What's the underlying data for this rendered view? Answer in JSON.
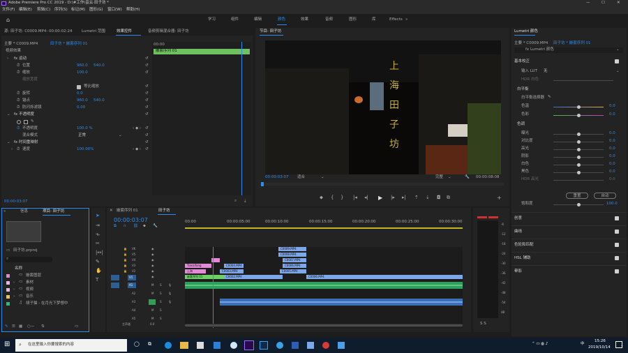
{
  "app": {
    "title": "Adobe Premiere Pro CC 2019 - D:\\#工作\\音云·田子坊 *",
    "min": "—",
    "max": "☐",
    "close": "✕"
  },
  "menu": [
    "文件(F)",
    "编辑(E)",
    "剪辑(C)",
    "序列(S)",
    "标记(M)",
    "图形(G)",
    "窗口(W)",
    "帮助(H)"
  ],
  "workspaces": [
    "学习",
    "组件",
    "编辑",
    "颜色",
    "效果",
    "音频",
    "图形",
    "库",
    "Effects"
  ],
  "source_panel": {
    "label": "源: 田子坊: C0009.MP4: 00:00:02:24",
    "tabs": [
      "Lumetri 范围",
      "效果控件",
      "音频剪辑混合器: 田子坊"
    ],
    "clip_path": "主要 * C0009.MP4",
    "seq_path": "田子坊 * 嵌套序列 01",
    "mini_time": "00:00",
    "mini_clip": "嵌套序列 01",
    "bottom_time": "00:00:03:07"
  },
  "effects": {
    "section": "视频效果",
    "rows": [
      {
        "label": "fx 运动",
        "v1": "",
        "v2": ""
      },
      {
        "label": "位置",
        "v1": "960.0",
        "v2": "540.0"
      },
      {
        "label": "缩放",
        "v1": "100.0",
        "v2": ""
      },
      {
        "label": "缩放宽度",
        "v1": "",
        "v2": ""
      },
      {
        "label": "等比缩放",
        "v1": "",
        "v2": ""
      },
      {
        "label": "旋转",
        "v1": "0.0",
        "v2": ""
      },
      {
        "label": "锚点",
        "v1": "960.0",
        "v2": "540.0"
      },
      {
        "label": "防闪烁滤镜",
        "v1": "0.00",
        "v2": ""
      },
      {
        "label": "fx 不透明度",
        "v1": "",
        "v2": ""
      },
      {
        "label": "不透明度",
        "v1": "100.0 %",
        "v2": ""
      },
      {
        "label": "混合模式",
        "v1": "正常",
        "v2": ""
      },
      {
        "label": "fx 时间重映射",
        "v1": "",
        "v2": ""
      },
      {
        "label": "速度",
        "v1": "100.00%",
        "v2": ""
      }
    ]
  },
  "program": {
    "label": "节目: 田子坊",
    "time_left": "00:00:03:07",
    "fit": "适合",
    "quality": "完整",
    "time_right": "00:00:08:08",
    "sign_text": [
      "上",
      "海",
      "田",
      "子",
      "坊"
    ]
  },
  "lumetri": {
    "title": "Lumetri 颜色",
    "path_left": "主要 * C0009.MP4",
    "path_right": "田子坊 * 嵌套序列 01",
    "fx": "fx Lumetri 颜色",
    "basic": "基本校正",
    "lut_label": "输入 LUT",
    "lut_value": "无",
    "hdr": "HDR 白色",
    "wb_section": "白平衡",
    "wb_picker": "白平衡选择器",
    "temp": {
      "label": "色温",
      "value": "0.0"
    },
    "tint": {
      "label": "色彩",
      "value": "0.0"
    },
    "tone": "色调",
    "tone_rows": [
      {
        "label": "曝光",
        "value": "0.0"
      },
      {
        "label": "对比度",
        "value": "0.0"
      },
      {
        "label": "高光",
        "value": "0.0"
      },
      {
        "label": "阴影",
        "value": "0.0"
      },
      {
        "label": "白色",
        "value": "0.0"
      },
      {
        "label": "黑色",
        "value": "0.0"
      },
      {
        "label": "HDR 高光",
        "value": "0.0"
      }
    ],
    "reset": "重置",
    "auto": "自动",
    "sat": {
      "label": "饱和度",
      "value": "100.0"
    },
    "sections": [
      "创意",
      "曲线",
      "色轮和匹配",
      "HSL 辅助",
      "晕影"
    ]
  },
  "project": {
    "tabs": [
      "项目: 田子坊",
      "媒体浏览器",
      "信息"
    ],
    "file": "田子坊.prproj",
    "search_placeholder": "",
    "col_header": "名称",
    "items": [
      {
        "name": "嵌套图层",
        "color": "#e28ad6"
      },
      {
        "name": "素材",
        "color": "#e9b5e4"
      },
      {
        "name": "视频",
        "color": "#e9b5e4"
      },
      {
        "name": "音乐",
        "color": "#e8c45c"
      },
      {
        "name": "胡子猫 - 在月光下梦想中",
        "color": "#27c070"
      }
    ]
  },
  "timeline": {
    "tabs": [
      "嵌套序列 01",
      "田子坊"
    ],
    "timecode": "00:00:03:07",
    "ruler": [
      "00:00",
      "00:00:05:00",
      "00:00:10:00",
      "00:00:15:00",
      "00:00:20:00",
      "00:00:25:00",
      "00:00:30:00"
    ],
    "tracks_v": [
      "V6",
      "V5",
      "V4",
      "V3",
      "V2",
      "V1"
    ],
    "tracks_a": [
      "A1",
      "A2",
      "A3",
      "A4",
      "A5"
    ],
    "master": "主声道",
    "master_val": "0.0",
    "clips": [
      "C0009.MP4",
      "C0008.MP4",
      "C0007.MP4",
      "C0006.MP4",
      "C0005.MP4",
      "C0004.MP4",
      "C0003.MP4",
      "C0002.MP4",
      "C0001.MP4",
      "上海",
      "Tianzifang",
      "嵌套序列 01",
      "C0006.MP4"
    ]
  },
  "meter": {
    "labels": [
      "-6",
      "-12",
      "-18",
      "-24",
      "-30",
      "-36",
      "-42",
      "-48",
      "-54",
      "dB"
    ],
    "bottom": "S S"
  },
  "taskbar": {
    "search": "在这里输入你要搜索的内容",
    "time": "15:26",
    "date": "2019/10/14",
    "lang": "中",
    "notif": "7"
  },
  "colors": {
    "accent": "#2d8ceb",
    "green_track": "#2fa05a",
    "clip_blue": "#7ea7ea",
    "clip_pink": "#e28ad6",
    "clip_green": "#6fd06a"
  }
}
